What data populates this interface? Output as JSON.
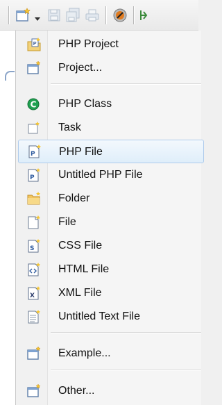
{
  "colors": {
    "menu_bg": "#f5f5f5",
    "highlight_border": "#aecbec",
    "highlight_bg": "#dfeefa",
    "php_class_green": "#1fa050"
  },
  "toolbar": {
    "icons": [
      "new-wizard-icon",
      "dropdown-arrow-icon",
      "save-icon",
      "save-all-icon",
      "print-icon",
      "php-debug-icon",
      "run-icon"
    ]
  },
  "menu": {
    "items": [
      {
        "label": "PHP Project",
        "icon": "php-project-icon"
      },
      {
        "label": "Project...",
        "icon": "project-icon"
      },
      {
        "label": "PHP Class",
        "icon": "php-class-icon"
      },
      {
        "label": "Task",
        "icon": "task-icon"
      },
      {
        "label": "PHP File",
        "icon": "php-file-icon",
        "highlighted": true
      },
      {
        "label": "Untitled PHP File",
        "icon": "untitled-php-file-icon"
      },
      {
        "label": "Folder",
        "icon": "folder-icon"
      },
      {
        "label": "File",
        "icon": "file-icon"
      },
      {
        "label": "CSS File",
        "icon": "css-file-icon"
      },
      {
        "label": "HTML File",
        "icon": "html-file-icon"
      },
      {
        "label": "XML File",
        "icon": "xml-file-icon"
      },
      {
        "label": "Untitled Text File",
        "icon": "untitled-text-file-icon"
      },
      {
        "label": "Example...",
        "icon": "example-icon"
      },
      {
        "label": "Other...",
        "icon": "other-icon"
      }
    ]
  }
}
